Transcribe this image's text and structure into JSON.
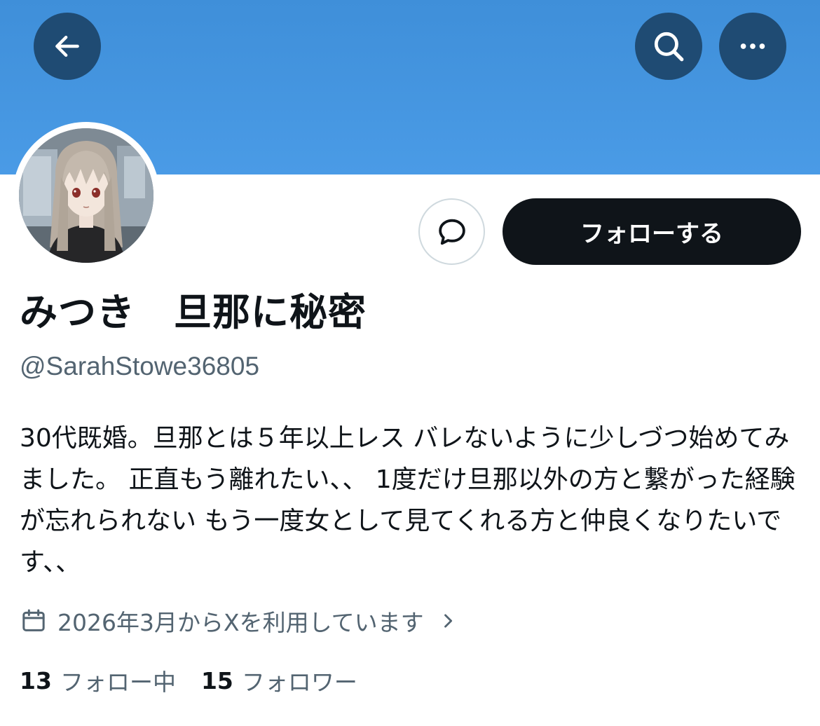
{
  "colors": {
    "banner": "#4a9be6",
    "header_button_bg": "#1f4b73",
    "follow_button_bg": "#0f1419",
    "secondary_text": "#536471"
  },
  "header": {
    "back_icon": "arrow-left-icon",
    "search_icon": "search-icon",
    "more_icon": "more-horizontal-icon"
  },
  "profile": {
    "display_name": "みつき　旦那に秘密",
    "handle": "@SarahStowe36805",
    "bio": "30代既婚。旦那とは５年以上レス バレないように少しづつ始めてみました。 正直もう離れたい、、 1度だけ旦那以外の方と繋がった経験が忘れられない もう一度女として見てくれる方と仲良くなりたいです、、",
    "joined": "2026年3月からXを利用しています",
    "following_count": "13",
    "following_label": "フォロー中",
    "followers_count": "15",
    "followers_label": "フォロワー"
  },
  "actions": {
    "message_icon": "message-bubble-icon",
    "follow_label": "フォローする"
  }
}
